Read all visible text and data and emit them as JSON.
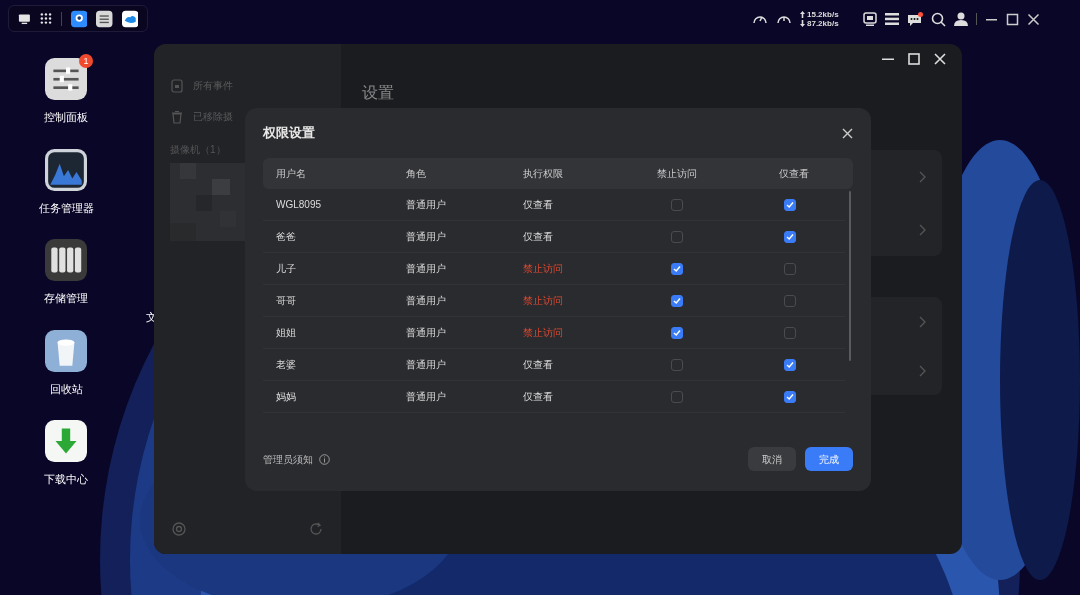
{
  "top_bar": {
    "net_up": "15.2kb/s",
    "net_down": "87.2kb/s",
    "notification_dot": true
  },
  "desktop_icons": [
    {
      "label": "控制面板",
      "kind": "control",
      "badge": "1"
    },
    {
      "label": "任务管理器",
      "kind": "monitor"
    },
    {
      "label": "存储管理",
      "kind": "storage"
    },
    {
      "label": "回收站",
      "kind": "trash"
    },
    {
      "label": "下载中心",
      "kind": "download"
    }
  ],
  "desktop_partial_label": "文",
  "window": {
    "title": "设置",
    "sidebar": {
      "items": [
        {
          "label": "所有事件",
          "kind": "events"
        },
        {
          "label": "已移除摄",
          "kind": "trash"
        }
      ],
      "section": "摄像机（1）"
    }
  },
  "dialog": {
    "title": "权限设置",
    "columns": [
      "用户名",
      "角色",
      "执行权限",
      "禁止访问",
      "仅查看"
    ],
    "rows": [
      {
        "user": "WGL8095",
        "role": "普通用户",
        "permission": "仅查看",
        "denied": false,
        "view_only": true
      },
      {
        "user": "爸爸",
        "role": "普通用户",
        "permission": "仅查看",
        "denied": false,
        "view_only": true
      },
      {
        "user": "儿子",
        "role": "普通用户",
        "permission": "禁止访问",
        "denied": true,
        "view_only": false
      },
      {
        "user": "哥哥",
        "role": "普通用户",
        "permission": "禁止访问",
        "denied": true,
        "view_only": false
      },
      {
        "user": "姐姐",
        "role": "普通用户",
        "permission": "禁止访问",
        "denied": true,
        "view_only": false
      },
      {
        "user": "老婆",
        "role": "普通用户",
        "permission": "仅查看",
        "denied": false,
        "view_only": true
      },
      {
        "user": "妈妈",
        "role": "普通用户",
        "permission": "仅查看",
        "denied": false,
        "view_only": true
      }
    ],
    "notice": "管理员须知",
    "buttons": [
      {
        "label": "取消",
        "kind": "secondary"
      },
      {
        "label": "完成",
        "kind": "primary"
      }
    ]
  }
}
